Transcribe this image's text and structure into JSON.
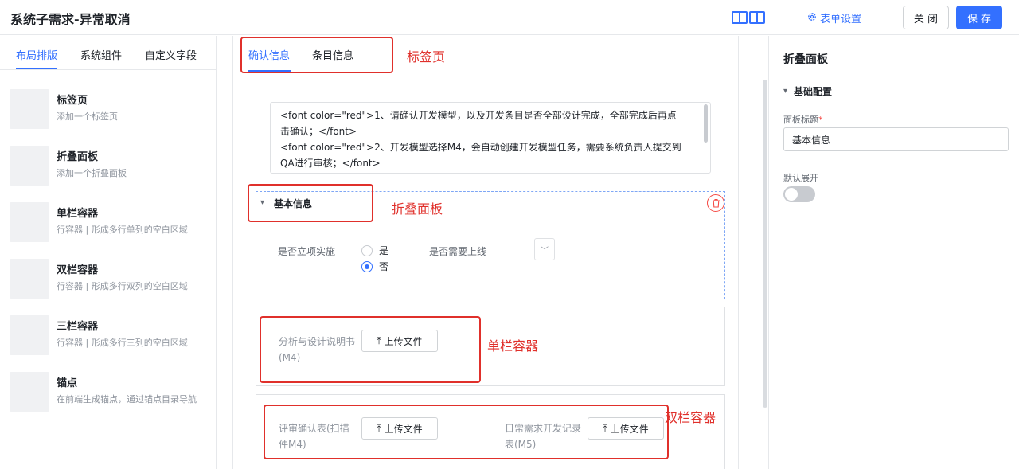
{
  "header": {
    "title": "系统子需求-异常取消",
    "form_settings": "表单设置",
    "close": "关 闭",
    "save": "保 存"
  },
  "left_panel": {
    "tabs": [
      "布局排版",
      "系统组件",
      "自定义字段"
    ],
    "active_tab": 0,
    "components": [
      {
        "name": "标签页",
        "desc": "添加一个标签页"
      },
      {
        "name": "折叠面板",
        "desc": "添加一个折叠面板"
      },
      {
        "name": "单栏容器",
        "desc": "行容器 | 形成多行单列的空白区域"
      },
      {
        "name": "双栏容器",
        "desc": "行容器 | 形成多行双列的空白区域"
      },
      {
        "name": "三栏容器",
        "desc": "行容器 | 形成多行三列的空白区域"
      },
      {
        "name": "锚点",
        "desc": "在前端生成锚点，通过锚点目录导航"
      }
    ]
  },
  "canvas": {
    "tabs": [
      "确认信息",
      "条目信息"
    ],
    "active_tab": 0,
    "note_lines": [
      "<font color=\"red\">1、请确认开发模型，以及开发条目是否全部设计完成，全部完成后再点",
      "击确认；</font>",
      "<font color=\"red\">2、开发模型选择M4，会自动创建开发模型任务，需要系统负责人提交到",
      "QA进行审核；</font>"
    ],
    "collapse_panel": {
      "title": "基本信息",
      "field1_label": "是否立项实施",
      "radio_yes": "是",
      "radio_no": "否",
      "selected": "否",
      "field2_label": "是否需要上线"
    },
    "single_column": {
      "label": "分析与设计说明书(M4)",
      "upload": "上传文件"
    },
    "double_column": {
      "left_label": "评审确认表(扫描件M4)",
      "right_label": "日常需求开发记录表(M5)",
      "upload": "上传文件"
    }
  },
  "right_panel": {
    "title": "折叠面板",
    "section": "基础配置",
    "panel_title_label": "面板标题",
    "panel_title_value": "基本信息",
    "default_expand_label": "默认展开",
    "default_expand": false
  },
  "annotations": {
    "tabs": "标签页",
    "collapse": "折叠面板",
    "single": "单栏容器",
    "double": "双栏容器"
  },
  "colors": {
    "accent": "#3370ff",
    "annotation": "#e0302b"
  }
}
